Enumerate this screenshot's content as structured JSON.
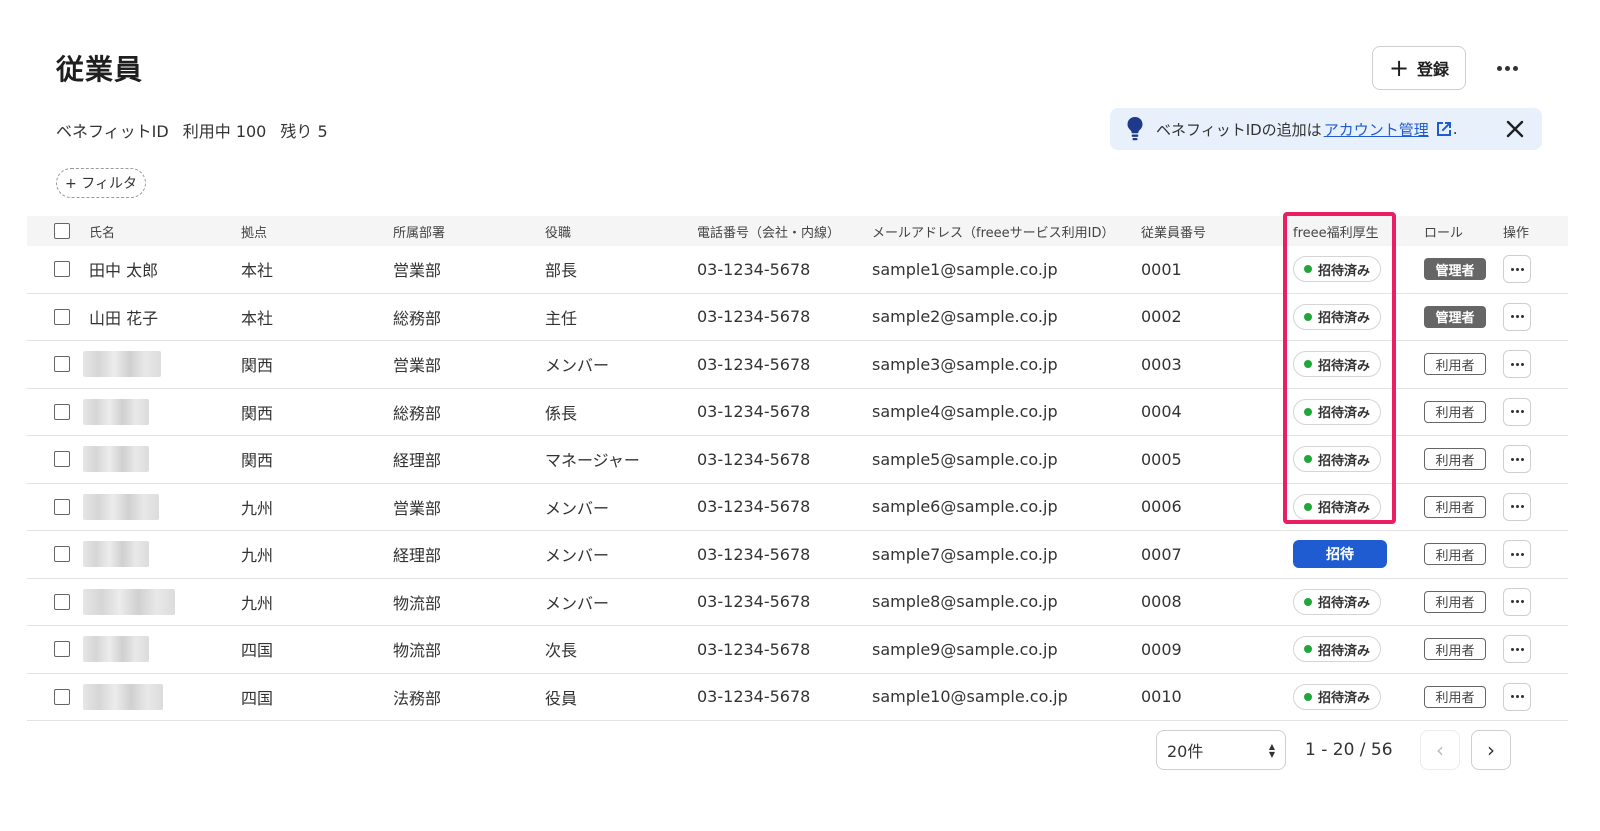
{
  "header": {
    "title": "従業員",
    "register_label": "登録"
  },
  "summary": {
    "label": "ベネフィットID",
    "in_use": "利用中 100",
    "remaining": "残り 5"
  },
  "banner": {
    "text_before": "ベネフィットIDの追加は",
    "link_text": "アカウント管理",
    "text_after": "."
  },
  "filter": {
    "label": "+ フィルタ"
  },
  "table": {
    "headers": {
      "name": "氏名",
      "base": "拠点",
      "dept": "所属部署",
      "title": "役職",
      "phone": "電話番号（会社・内線）",
      "mail": "メールアドレス（freeeサービス利用ID）",
      "empno": "従業員番号",
      "freee": "freee福利厚生",
      "role": "ロール",
      "ops": "操作"
    },
    "rows": [
      {
        "name": "田中 太郎",
        "base": "本社",
        "dept": "営業部",
        "title": "部長",
        "phone": "03-1234-5678",
        "mail": "sample1@sample.co.jp",
        "empno": "0001",
        "status": "招待済み",
        "role": "管理者"
      },
      {
        "name": "山田 花子",
        "base": "本社",
        "dept": "総務部",
        "title": "主任",
        "phone": "03-1234-5678",
        "mail": "sample2@sample.co.jp",
        "empno": "0002",
        "status": "招待済み",
        "role": "管理者"
      },
      {
        "name": "",
        "base": "関西",
        "dept": "営業部",
        "title": "メンバー",
        "phone": "03-1234-5678",
        "mail": "sample3@sample.co.jp",
        "empno": "0003",
        "status": "招待済み",
        "role": "利用者"
      },
      {
        "name": "",
        "base": "関西",
        "dept": "総務部",
        "title": "係長",
        "phone": "03-1234-5678",
        "mail": "sample4@sample.co.jp",
        "empno": "0004",
        "status": "招待済み",
        "role": "利用者"
      },
      {
        "name": "",
        "base": "関西",
        "dept": "経理部",
        "title": "マネージャー",
        "phone": "03-1234-5678",
        "mail": "sample5@sample.co.jp",
        "empno": "0005",
        "status": "招待済み",
        "role": "利用者"
      },
      {
        "name": "",
        "base": "九州",
        "dept": "営業部",
        "title": "メンバー",
        "phone": "03-1234-5678",
        "mail": "sample6@sample.co.jp",
        "empno": "0006",
        "status": "招待済み",
        "role": "利用者"
      },
      {
        "name": "",
        "base": "九州",
        "dept": "経理部",
        "title": "メンバー",
        "phone": "03-1234-5678",
        "mail": "sample7@sample.co.jp",
        "empno": "0007",
        "status": "招待",
        "role": "利用者"
      },
      {
        "name": "",
        "base": "九州",
        "dept": "物流部",
        "title": "メンバー",
        "phone": "03-1234-5678",
        "mail": "sample8@sample.co.jp",
        "empno": "0008",
        "status": "招待済み",
        "role": "利用者"
      },
      {
        "name": "",
        "base": "四国",
        "dept": "物流部",
        "title": "次長",
        "phone": "03-1234-5678",
        "mail": "sample9@sample.co.jp",
        "empno": "0009",
        "status": "招待済み",
        "role": "利用者"
      },
      {
        "name": "",
        "base": "四国",
        "dept": "法務部",
        "title": "役員",
        "phone": "03-1234-5678",
        "mail": "sample10@sample.co.jp",
        "empno": "0010",
        "status": "招待済み",
        "role": "利用者"
      }
    ]
  },
  "pagination": {
    "per_page": "20件",
    "range": "1 - 20 / 56"
  },
  "colors": {
    "accent_blue": "#1f5bd1",
    "status_green": "#22a63a",
    "highlight": "#e91e63",
    "banner_bg": "#e8f0fb"
  },
  "icons": [
    "plus-icon",
    "more-icon",
    "lightbulb-icon",
    "external-link-icon",
    "close-icon",
    "chevron-left-icon",
    "chevron-right-icon"
  ]
}
